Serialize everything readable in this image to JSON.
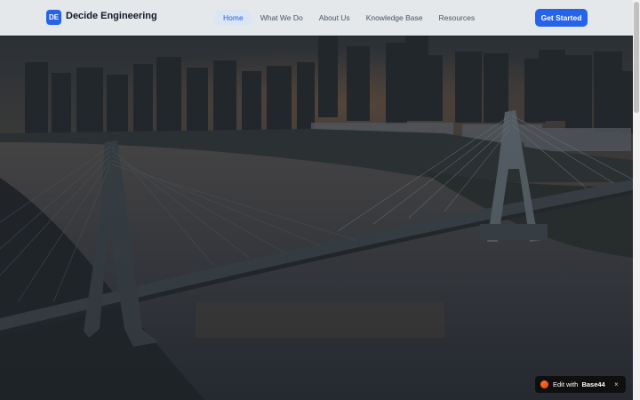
{
  "header": {
    "logo_initials": "DE",
    "brand": "Decide Engineering",
    "nav": [
      {
        "label": "Home",
        "active": true
      },
      {
        "label": "What We Do",
        "active": false
      },
      {
        "label": "About Us",
        "active": false
      },
      {
        "label": "Knowledge Base",
        "active": false
      },
      {
        "label": "Resources",
        "active": false
      }
    ],
    "cta_label": "Get Started"
  },
  "edit_badge": {
    "prefix": "Edit with",
    "brand": "Base44",
    "close_symbol": "×",
    "logo_icon": "base44-logo-icon"
  },
  "colors": {
    "accent": "#2563eb",
    "nav_active_bg": "#dbe5f3",
    "header_bg": "#ebeef1",
    "badge_bg": "#0f0f10"
  }
}
